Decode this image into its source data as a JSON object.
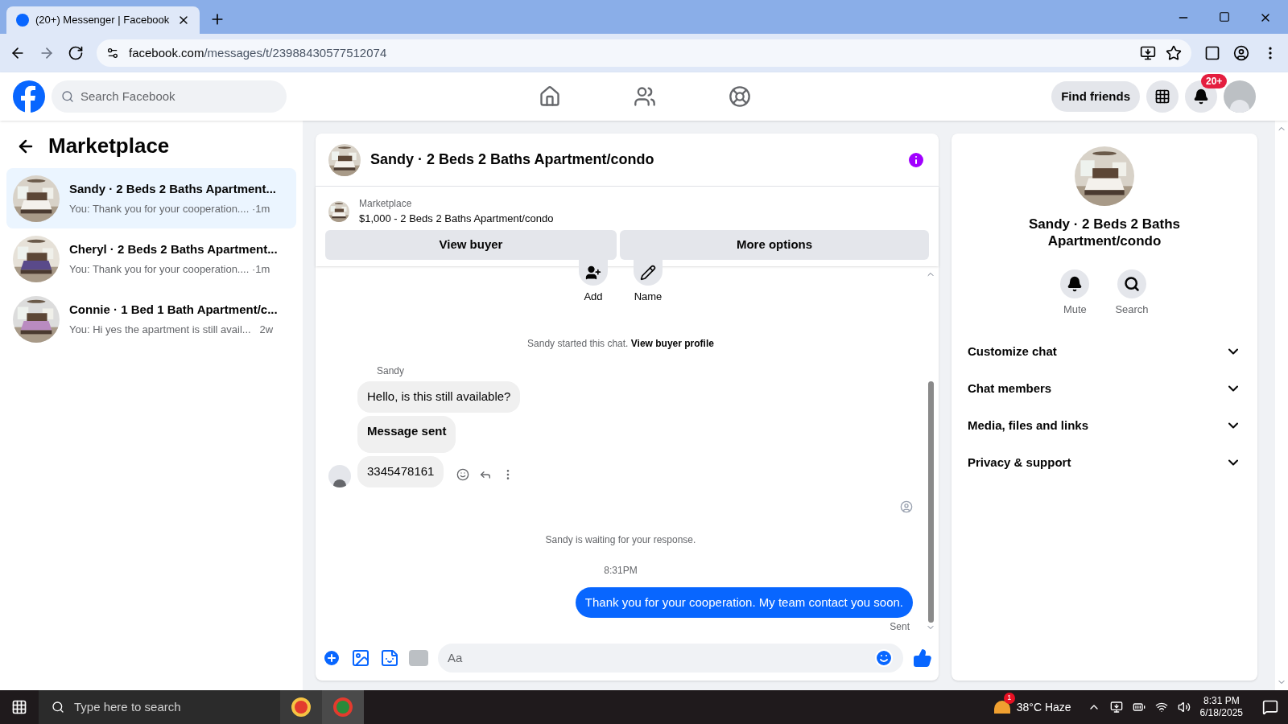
{
  "browser": {
    "tab_title": "(20+) Messenger | Facebook",
    "url_domain": "facebook.com",
    "url_path": "/messages/t/23988430577512074"
  },
  "header": {
    "search_placeholder": "Search Facebook",
    "find_friends": "Find friends",
    "notification_badge": "20+"
  },
  "sidebar": {
    "title": "Marketplace",
    "conversations": [
      {
        "name": "Sandy · 2 Beds 2 Baths Apartment...",
        "preview": "You: Thank you for your cooperation.... ·1m",
        "selected": true
      },
      {
        "name": "Cheryl · 2 Beds 2 Baths Apartment...",
        "preview": "You: Thank you for your cooperation.... ·1m",
        "selected": false
      },
      {
        "name": "Connie · 1 Bed 1 Bath Apartment/c...",
        "preview": "You: Hi yes the apartment is still avail...   2w",
        "selected": false
      }
    ]
  },
  "chat": {
    "title": "Sandy · 2 Beds 2 Baths Apartment/condo",
    "listing": {
      "label": "Marketplace",
      "detail": "$1,000 - 2 Beds 2 Baths Apartment/condo"
    },
    "buttons": [
      "View buyer",
      "More options"
    ],
    "actions": [
      {
        "kind": "add",
        "label": "Add"
      },
      {
        "kind": "name",
        "label": "Name"
      }
    ],
    "started": {
      "text": "Sandy started this chat.",
      "link": "View buyer profile"
    },
    "sender": "Sandy",
    "received": [
      {
        "text": "Hello, is this still available?",
        "bold": false
      },
      {
        "text": "Message sent",
        "bold": true
      },
      {
        "text": "3345478161",
        "bold": false
      }
    ],
    "waiting": "Sandy is waiting for your response.",
    "time": "8:31PM",
    "sent": {
      "text": "Thank you for your cooperation. My team contact you soon.",
      "status": "Sent"
    },
    "composer_placeholder": "Aa"
  },
  "info": {
    "title": "Sandy · 2 Beds 2 Baths Apartment/condo",
    "actions": [
      {
        "kind": "mute",
        "label": "Mute"
      },
      {
        "kind": "search",
        "label": "Search"
      }
    ],
    "sections": [
      "Customize chat",
      "Chat members",
      "Media, files and links",
      "Privacy & support"
    ]
  },
  "taskbar": {
    "search_placeholder": "Type here to search",
    "weather_badge": "1",
    "temperature": "38°C",
    "condition": "Haze",
    "time": "8:31 PM",
    "date": "6/18/2025"
  }
}
